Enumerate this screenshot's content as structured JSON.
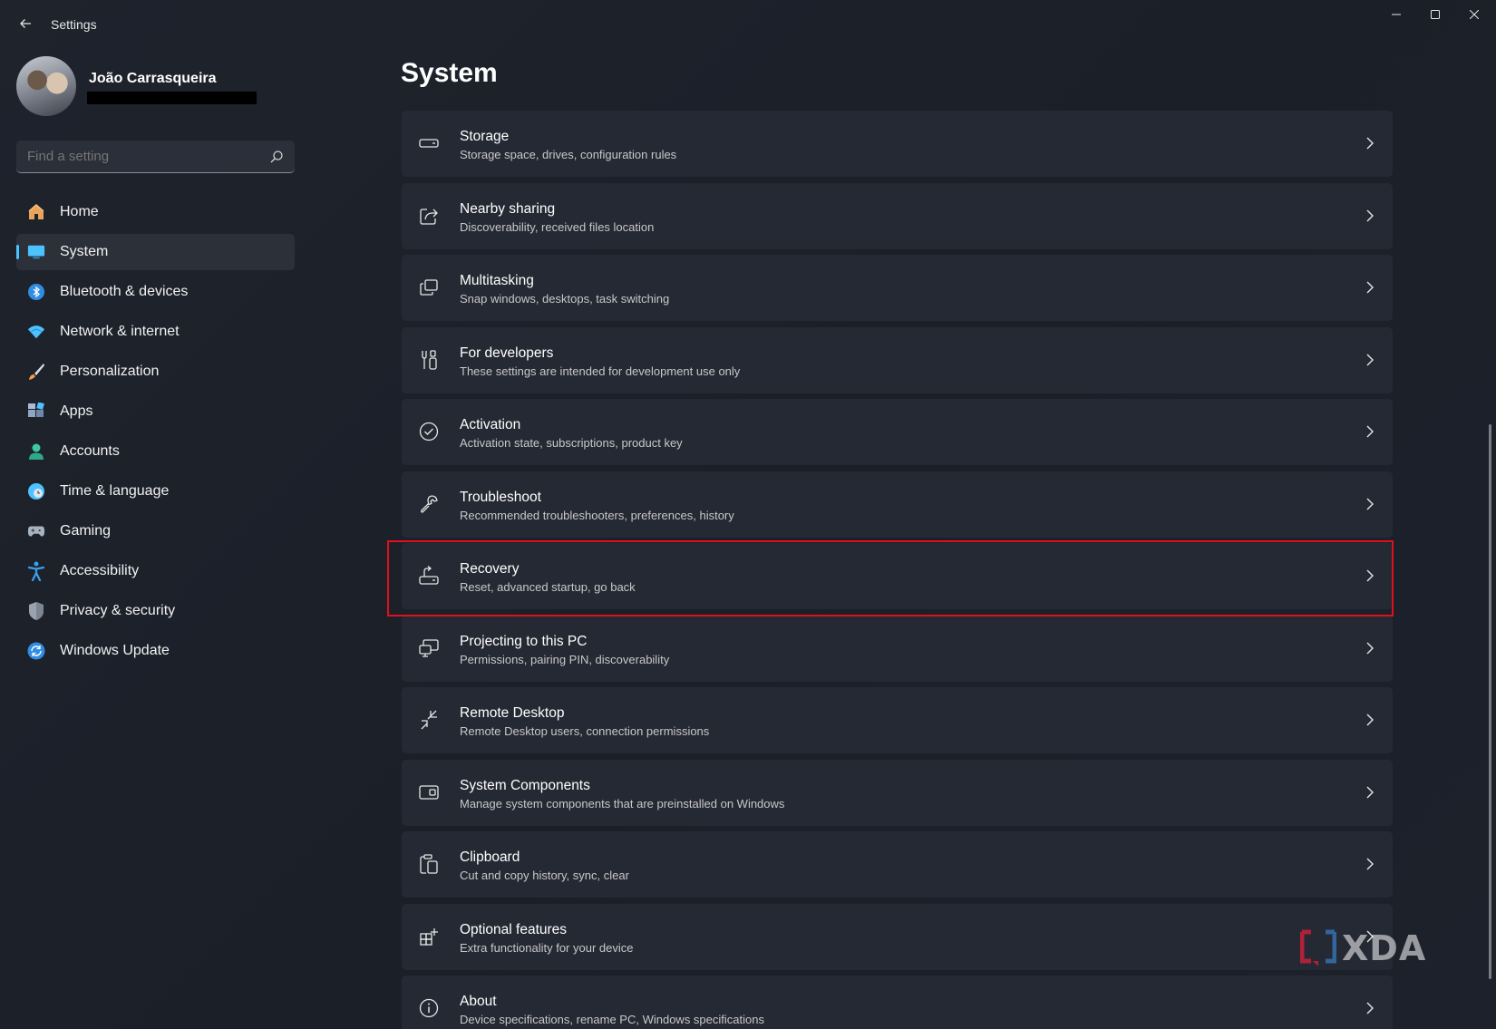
{
  "window": {
    "title": "Settings",
    "controls": [
      "minimize-icon",
      "maximize-icon",
      "close-icon"
    ]
  },
  "profile": {
    "name": "João Carrasqueira"
  },
  "search": {
    "placeholder": "Find a setting"
  },
  "sidebar": {
    "items": [
      {
        "label": "Home",
        "icon": "home-icon",
        "color": "#e8a45a"
      },
      {
        "label": "System",
        "icon": "system-icon",
        "color": "#4cc2ff",
        "selected": true
      },
      {
        "label": "Bluetooth & devices",
        "icon": "bluetooth-icon",
        "color": "#2f8de4"
      },
      {
        "label": "Network & internet",
        "icon": "wifi-icon",
        "color": "#4cc2ff"
      },
      {
        "label": "Personalization",
        "icon": "brush-icon",
        "color": "#f0a04b"
      },
      {
        "label": "Apps",
        "icon": "apps-icon",
        "color": "#8ea6c4"
      },
      {
        "label": "Accounts",
        "icon": "accounts-icon",
        "color": "#3fc6a6"
      },
      {
        "label": "Time & language",
        "icon": "globe-clock-icon",
        "color": "#4cc2ff"
      },
      {
        "label": "Gaming",
        "icon": "gamepad-icon",
        "color": "#a8b3c2"
      },
      {
        "label": "Accessibility",
        "icon": "accessibility-icon",
        "color": "#3aa0f0"
      },
      {
        "label": "Privacy & security",
        "icon": "shield-icon",
        "color": "#9aa3ad"
      },
      {
        "label": "Windows Update",
        "icon": "update-icon",
        "color": "#2f8de4"
      }
    ]
  },
  "main": {
    "title": "System",
    "cards": [
      {
        "title": "Storage",
        "subtitle": "Storage space, drives, configuration rules",
        "icon": "storage-icon"
      },
      {
        "title": "Nearby sharing",
        "subtitle": "Discoverability, received files location",
        "icon": "share-icon"
      },
      {
        "title": "Multitasking",
        "subtitle": "Snap windows, desktops, task switching",
        "icon": "multitasking-icon"
      },
      {
        "title": "For developers",
        "subtitle": "These settings are intended for development use only",
        "icon": "developer-tools-icon"
      },
      {
        "title": "Activation",
        "subtitle": "Activation state, subscriptions, product key",
        "icon": "activation-check-icon"
      },
      {
        "title": "Troubleshoot",
        "subtitle": "Recommended troubleshooters, preferences, history",
        "icon": "wrench-icon"
      },
      {
        "title": "Recovery",
        "subtitle": "Reset, advanced startup, go back",
        "icon": "recovery-icon",
        "highlighted": true
      },
      {
        "title": "Projecting to this PC",
        "subtitle": "Permissions, pairing PIN, discoverability",
        "icon": "projecting-icon"
      },
      {
        "title": "Remote Desktop",
        "subtitle": "Remote Desktop users, connection permissions",
        "icon": "remote-desktop-icon"
      },
      {
        "title": "System Components",
        "subtitle": "Manage system components that are preinstalled on Windows",
        "icon": "system-components-icon"
      },
      {
        "title": "Clipboard",
        "subtitle": "Cut and copy history, sync, clear",
        "icon": "clipboard-icon"
      },
      {
        "title": "Optional features",
        "subtitle": "Extra functionality for your device",
        "icon": "optional-features-icon"
      },
      {
        "title": "About",
        "subtitle": "Device specifications, rename PC, Windows specifications",
        "icon": "info-icon"
      }
    ]
  },
  "watermark": {
    "text": "XDA"
  }
}
